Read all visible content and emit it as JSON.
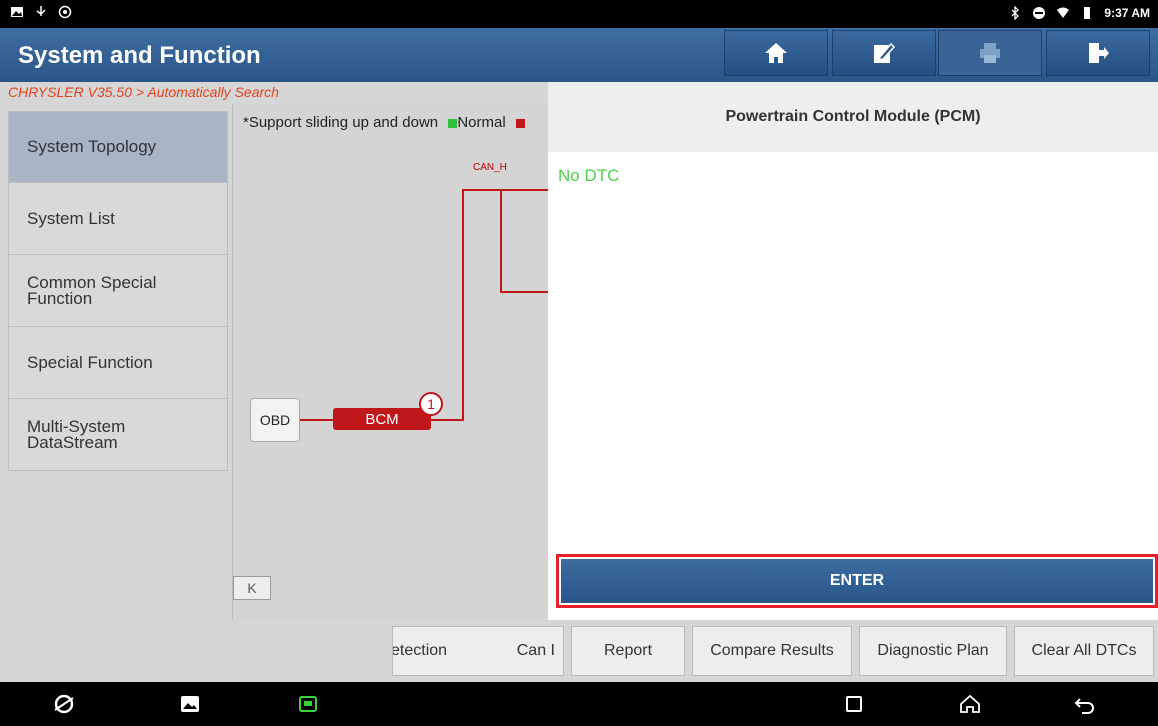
{
  "status_bar": {
    "time": "9:37 AM"
  },
  "header": {
    "title": "System and Function",
    "buttons": [
      {
        "name": "home",
        "icon": "home-icon"
      },
      {
        "name": "edit",
        "icon": "edit-icon"
      },
      {
        "name": "print",
        "icon": "print-icon"
      },
      {
        "name": "exit",
        "icon": "exit-icon"
      }
    ]
  },
  "breadcrumb": "CHRYSLER V35.50 > Automatically Search",
  "sidebar": {
    "items": [
      {
        "label": "System Topology",
        "active": true
      },
      {
        "label": "System List",
        "active": false
      },
      {
        "label": "Common Special Function",
        "active": false
      },
      {
        "label": "Special Function",
        "active": false
      },
      {
        "label": "Multi-System DataStream",
        "active": false
      }
    ]
  },
  "topology": {
    "hint": "*Support sliding up and down",
    "legend": [
      {
        "label": "Normal",
        "color": "#2fbf3a"
      },
      {
        "label": "",
        "color": "#c0171b"
      }
    ],
    "bus_label": "CAN_H",
    "obd_label": "OBD",
    "module_label": "BCM",
    "module_number": "1",
    "collapse_label": "K"
  },
  "panel": {
    "title": "Powertrain Control Module (PCM)",
    "status": "No DTC",
    "enter_label": "ENTER"
  },
  "actions": {
    "buttons": [
      {
        "label": "etection"
      },
      {
        "label": "Can I"
      },
      {
        "label": "Report"
      },
      {
        "label": "Compare Results"
      },
      {
        "label": "Diagnostic Plan"
      },
      {
        "label": "Clear All DTCs"
      }
    ]
  },
  "colors": {
    "accent": "#2a5688",
    "highlight": "#e3202c",
    "ok": "#4dd24d",
    "module": "#c0171b"
  }
}
